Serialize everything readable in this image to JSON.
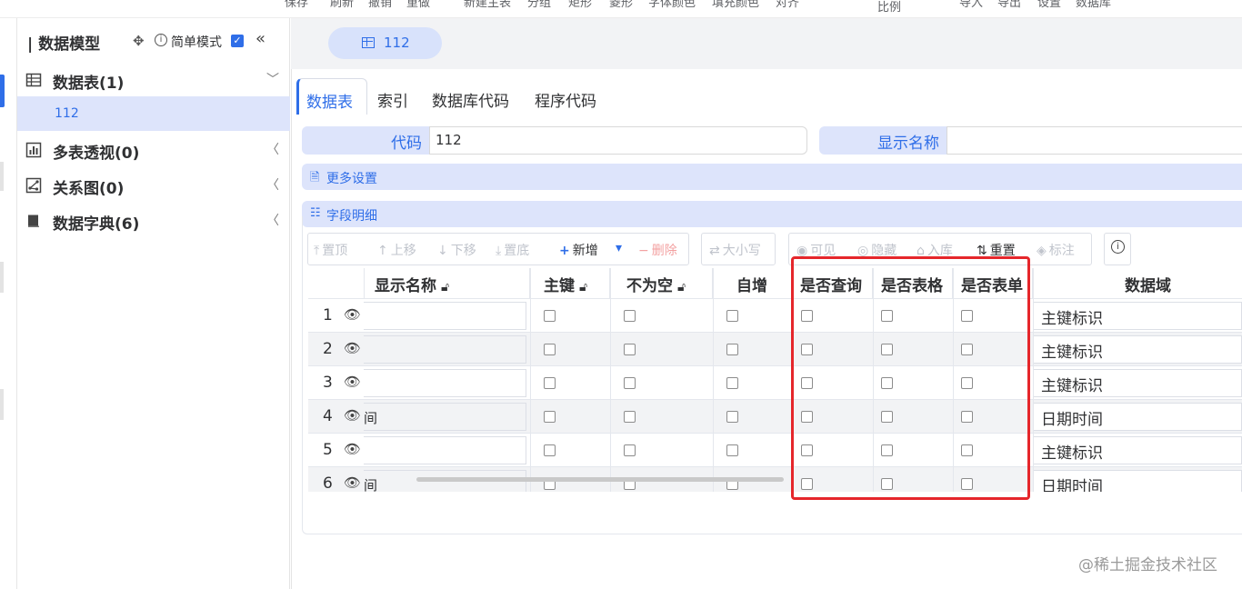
{
  "top_toolbar": [
    "保存",
    "刷新",
    "撤销",
    "重做",
    "新建主表",
    "分组",
    "矩形",
    "菱形",
    "字体颜色",
    "填充颜色",
    "对齐",
    "比例",
    "导入",
    "导出",
    "设置",
    "数据库"
  ],
  "sidebar": {
    "title": "| 数据模型",
    "simple_mode_label": "简单模式",
    "simple_mode_checked": true,
    "items": [
      {
        "label": "数据表(1)",
        "icon": "table-icon",
        "expanded": true
      },
      {
        "label": "多表透视(0)",
        "icon": "pivot-chart-icon",
        "expanded": false
      },
      {
        "label": "关系图(0)",
        "icon": "relation-graph-icon",
        "expanded": false
      },
      {
        "label": "数据字典(6)",
        "icon": "book-icon",
        "expanded": false
      }
    ],
    "sub_item": "112"
  },
  "main": {
    "open_tab": "112",
    "subtabs": [
      "数据表",
      "索引",
      "数据库代码",
      "程序代码"
    ],
    "active_subtab": "数据表",
    "form": {
      "code_label": "代码",
      "code_value": "112",
      "display_name_label": "显示名称",
      "display_name_value": ""
    },
    "more_settings": "更多设置",
    "field_details": "字段明细",
    "toolbar": {
      "top": "置顶",
      "up": "上移",
      "down": "下移",
      "bottom": "置底",
      "add": "新增",
      "delete": "删除",
      "case": "大小写",
      "visible": "可见",
      "hidden": "隐藏",
      "store": "入库",
      "reset": "重置",
      "mark": "标注"
    },
    "grid": {
      "headers": [
        "显示名称",
        "主键",
        "不为空",
        "自增",
        "是否查询",
        "是否表格",
        "是否表单",
        "数据域"
      ],
      "rows": [
        {
          "n": "1",
          "name": "",
          "domain": "主键标识"
        },
        {
          "n": "2",
          "name": "",
          "domain": "主键标识"
        },
        {
          "n": "3",
          "name": "",
          "domain": "主键标识"
        },
        {
          "n": "4",
          "name": "间",
          "domain": "日期时间"
        },
        {
          "n": "5",
          "name": "",
          "domain": "主键标识"
        },
        {
          "n": "6",
          "name": "间",
          "domain": "日期时间"
        }
      ]
    }
  },
  "watermark": "@稀土掘金技术社区",
  "colors": {
    "accent": "#2f6ee8",
    "tab_bg": "#dde4fb",
    "highlight": "#e5262b"
  }
}
